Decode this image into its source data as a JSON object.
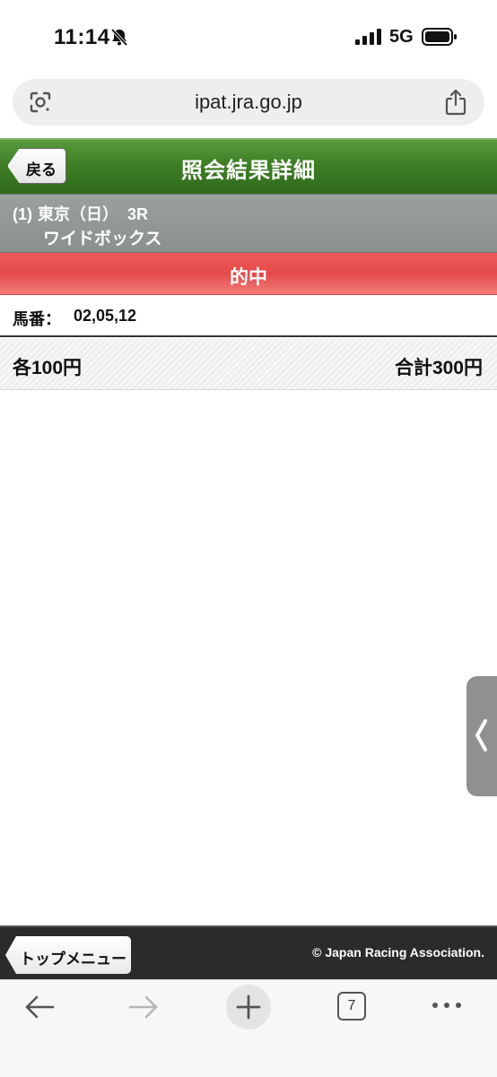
{
  "status_bar": {
    "time": "11:14",
    "network": "5G"
  },
  "browser": {
    "url": "ipat.jra.go.jp",
    "tab_count": "7"
  },
  "header": {
    "back_label": "戻る",
    "title": "照会結果詳細"
  },
  "race": {
    "number": "(1)",
    "venue_day": "東京（日）",
    "race_name": "3R",
    "bet_type": "ワイドボックス"
  },
  "result": {
    "label": "的中"
  },
  "horses": {
    "label": "馬番：",
    "values": "02,05,12"
  },
  "amount": {
    "each": "各100円",
    "total": "合計300円"
  },
  "footer": {
    "top_menu_label": "トップメニュー",
    "copyright": "© Japan Racing Association."
  },
  "colors": {
    "header_green": "#3e7d25",
    "result_red": "#e44a48",
    "race_gray": "#8a918c",
    "footer_dark": "#2b2b2b"
  },
  "icons": {
    "status": [
      "bell-off-icon",
      "signal-icon",
      "battery-icon"
    ],
    "url_bar": [
      "lens-icon",
      "share-icon"
    ],
    "toolbar": [
      "arrow-left-icon",
      "arrow-right-icon",
      "plus-icon",
      "tabs-icon",
      "more-icon"
    ],
    "side": "chevron-left-icon"
  }
}
